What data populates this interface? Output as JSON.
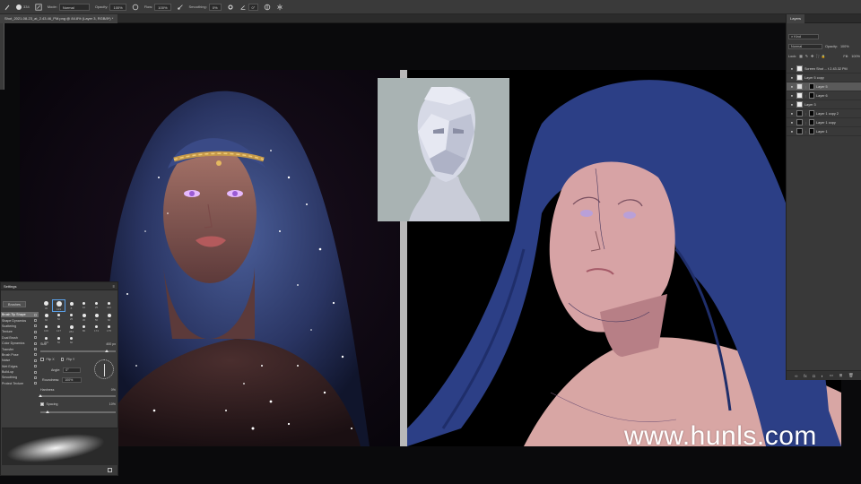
{
  "optbar": {
    "brush_size": "334",
    "mode_label": "Mode:",
    "mode_value": "Normal",
    "opacity_label": "Opacity:",
    "opacity_value": "100%",
    "flow_label": "Flow:",
    "flow_value": "100%",
    "smoothing_label": "Smoothing:",
    "smoothing_value": "0%",
    "angle_value": "0°"
  },
  "document": {
    "tab_title": "Shot_2021-08-23_at_2.43.46_PM.png @ 84.8% (Layer 3, RGB/8*) *"
  },
  "brush_settings": {
    "title": "Settings",
    "brushes_button": "Brushes",
    "options": [
      {
        "label": "Brush Tip Shape",
        "selected": true
      },
      {
        "label": "Shape Dynamics",
        "selected": false
      },
      {
        "label": "Scattering",
        "selected": false
      },
      {
        "label": "Texture",
        "selected": false
      },
      {
        "label": "Dual Brush",
        "selected": false
      },
      {
        "label": "Color Dynamics",
        "selected": false
      },
      {
        "label": "Transfer",
        "selected": false
      },
      {
        "label": "Brush Pose",
        "selected": false
      },
      {
        "label": "Noise",
        "selected": false
      },
      {
        "label": "Wet Edges",
        "selected": false
      },
      {
        "label": "Build-up",
        "selected": false
      },
      {
        "label": "Smoothing",
        "selected": false
      },
      {
        "label": "Protect Texture",
        "selected": false
      }
    ],
    "tips": [
      "30",
      "123",
      "8",
      "10",
      "25",
      "112",
      "60",
      "50",
      "25",
      "30",
      "50",
      "60",
      "100",
      "127",
      "284",
      "80",
      "174",
      "175",
      "306",
      "50",
      "60",
      "",
      "",
      ""
    ],
    "size_label": "Size",
    "size_value": "400 px",
    "flip_x_label": "Flip X",
    "flip_y_label": "Flip Y",
    "angle_label": "Angle:",
    "angle_value": "0°",
    "roundness_label": "Roundness:",
    "roundness_value": "100%",
    "hardness_label": "Hardness",
    "hardness_value": "0%",
    "spacing_label": "Spacing",
    "spacing_value": "10%"
  },
  "layers_panel": {
    "tab_label": "Layers",
    "kind_label": "Kind",
    "blend_mode": "Normal",
    "opacity_label": "Opacity:",
    "opacity_value": "100%",
    "lock_label": "Lock:",
    "fill_label": "Fill:",
    "fill_value": "100%",
    "layers": [
      {
        "name": "Screen Shot ... t 2.43.32 PM",
        "thumb": "light",
        "mask": false,
        "selected": false
      },
      {
        "name": "Layer 5 copy",
        "thumb": "light",
        "mask": false,
        "selected": false
      },
      {
        "name": "Layer 5",
        "thumb": "grp",
        "mask": true,
        "selected": true
      },
      {
        "name": "Layer 6",
        "thumb": "light",
        "mask": true,
        "selected": false
      },
      {
        "name": "Layer 3",
        "thumb": "light",
        "mask": false,
        "selected": false
      },
      {
        "name": "Layer 1 copy 2",
        "thumb": "dark",
        "mask": true,
        "selected": false
      },
      {
        "name": "Layer 1 copy",
        "thumb": "dark",
        "mask": true,
        "selected": false
      },
      {
        "name": "Layer 1",
        "thumb": "dark",
        "mask": true,
        "selected": false
      }
    ]
  },
  "watermark": "www.hunls.com",
  "colors": {
    "hair_blue": "#2c3f86",
    "skin_pink": "#d8a6a4",
    "ref_bg": "#a9b3b3",
    "panel_bg": "#3d3d3d"
  }
}
